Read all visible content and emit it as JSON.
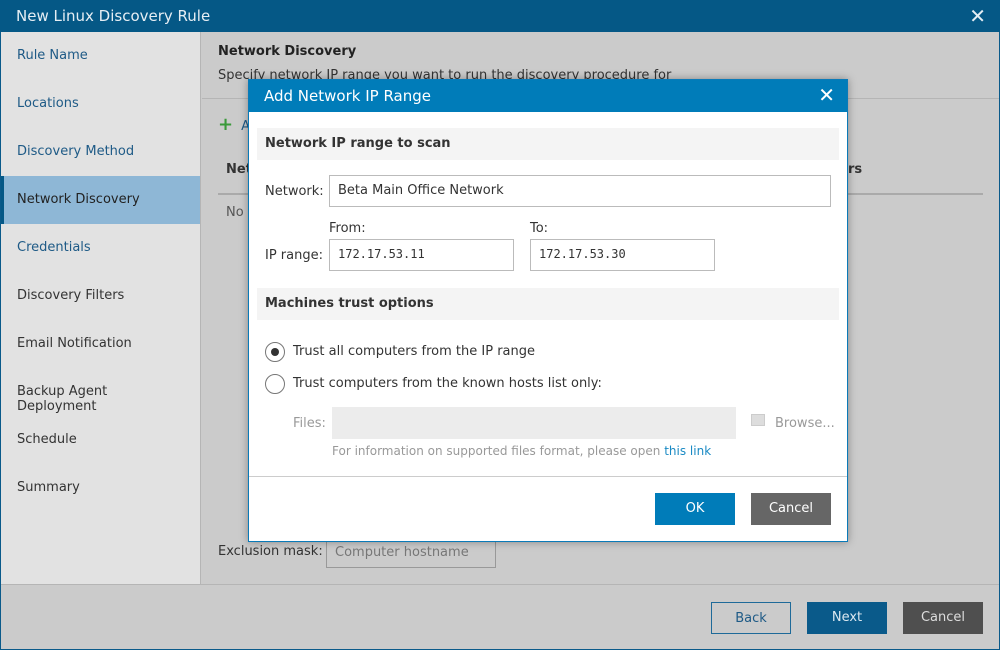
{
  "window": {
    "title": "New Linux Discovery Rule",
    "close_icon": "close-icon"
  },
  "sidebar": {
    "items": [
      {
        "label": "Rule Name",
        "state": "done"
      },
      {
        "label": "Locations",
        "state": "done"
      },
      {
        "label": "Discovery Method",
        "state": "done"
      },
      {
        "label": "Network Discovery",
        "state": "active"
      },
      {
        "label": "Credentials",
        "state": "done"
      },
      {
        "label": "Discovery Filters",
        "state": "todo"
      },
      {
        "label": "Email Notification",
        "state": "todo"
      },
      {
        "label": "Backup Agent Deployment",
        "state": "todo"
      },
      {
        "label": "Schedule",
        "state": "todo"
      },
      {
        "label": "Summary",
        "state": "todo"
      }
    ]
  },
  "main": {
    "title": "Network Discovery",
    "description": "Specify network IP range you want to run the discovery procedure for",
    "add_label": "A",
    "col1_partial": "Net",
    "col2_partial": "rs",
    "empty_partial": "No",
    "exclusion_label": "Exclusion mask:",
    "exclusion_placeholder": "Computer hostname"
  },
  "footer": {
    "back": "Back",
    "next": "Next",
    "cancel": "Cancel"
  },
  "dialog": {
    "title": "Add Network IP Range",
    "section1": "Network IP range to scan",
    "network_label": "Network:",
    "network_value": "Beta Main Office Network",
    "from_label": "From:",
    "to_label": "To:",
    "range_label": "IP range:",
    "from_value": "172.17.53.11",
    "to_value": "172.17.53.30",
    "section2": "Machines trust options",
    "trust_all": "Trust all computers from the IP range",
    "trust_all_selected": true,
    "trust_known": "Trust computers from the known hosts list only:",
    "files_label": "Files:",
    "browse": "Browse...",
    "info_text": "For information on supported files format, please open ",
    "info_link": "this link",
    "ok": "OK",
    "cancel": "Cancel"
  },
  "colors": {
    "accent": "#007cb9",
    "ok": "#007cb9",
    "cancel": "#666666",
    "title_bar": "#055886"
  }
}
